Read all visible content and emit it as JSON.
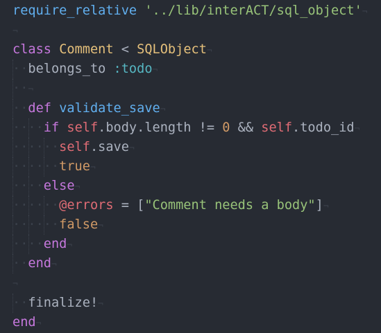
{
  "editor": {
    "language": "Ruby",
    "colors": {
      "background": "#272b33",
      "function": "#61afef",
      "string": "#98c379",
      "keyword": "#c678dd",
      "class": "#e5c07b",
      "symbol": "#56b6c2",
      "self": "#e06c75",
      "number": "#d19a66",
      "plain": "#abb2bf"
    },
    "lines": [
      {
        "indent": 0,
        "tokens": [
          {
            "t": "require_relative",
            "k": "fn"
          },
          {
            "t": " ",
            "k": "plain"
          },
          {
            "t": "'../lib/interACT/sql_object'",
            "k": "str"
          }
        ]
      },
      {
        "indent": 0,
        "tokens": []
      },
      {
        "indent": 0,
        "tokens": [
          {
            "t": "class",
            "k": "kw"
          },
          {
            "t": " ",
            "k": "plain"
          },
          {
            "t": "Comment",
            "k": "cls"
          },
          {
            "t": " < ",
            "k": "plain"
          },
          {
            "t": "SQLObject",
            "k": "cls"
          }
        ]
      },
      {
        "indent": 1,
        "tokens": [
          {
            "t": "belongs_to",
            "k": "plain"
          },
          {
            "t": " ",
            "k": "plain"
          },
          {
            "t": ":todo",
            "k": "sym"
          }
        ]
      },
      {
        "indent": 1,
        "tokens": []
      },
      {
        "indent": 1,
        "tokens": [
          {
            "t": "def",
            "k": "kw"
          },
          {
            "t": " ",
            "k": "plain"
          },
          {
            "t": "validate_save",
            "k": "fn"
          }
        ]
      },
      {
        "indent": 2,
        "tokens": [
          {
            "t": "if",
            "k": "kw"
          },
          {
            "t": " ",
            "k": "plain"
          },
          {
            "t": "self",
            "k": "self"
          },
          {
            "t": ".body.length != ",
            "k": "plain"
          },
          {
            "t": "0",
            "k": "num"
          },
          {
            "t": " && ",
            "k": "plain"
          },
          {
            "t": "self",
            "k": "self"
          },
          {
            "t": ".todo_id",
            "k": "plain"
          }
        ]
      },
      {
        "indent": 3,
        "tokens": [
          {
            "t": "self",
            "k": "self"
          },
          {
            "t": ".save",
            "k": "plain"
          }
        ]
      },
      {
        "indent": 3,
        "tokens": [
          {
            "t": "true",
            "k": "bool"
          }
        ]
      },
      {
        "indent": 2,
        "tokens": [
          {
            "t": "else",
            "k": "kw"
          }
        ]
      },
      {
        "indent": 3,
        "tokens": [
          {
            "t": "@errors",
            "k": "ivar"
          },
          {
            "t": " = [",
            "k": "plain"
          },
          {
            "t": "\"Comment needs a body\"",
            "k": "str"
          },
          {
            "t": "]",
            "k": "plain"
          }
        ]
      },
      {
        "indent": 3,
        "tokens": [
          {
            "t": "false",
            "k": "bool"
          }
        ]
      },
      {
        "indent": 2,
        "tokens": [
          {
            "t": "end",
            "k": "kw"
          }
        ]
      },
      {
        "indent": 1,
        "tokens": [
          {
            "t": "end",
            "k": "kw"
          }
        ]
      },
      {
        "indent": 0,
        "tokens": []
      },
      {
        "indent": 1,
        "tokens": [
          {
            "t": "finalize!",
            "k": "plain"
          }
        ]
      },
      {
        "indent": 0,
        "tokens": [
          {
            "t": "end",
            "k": "kw"
          }
        ]
      }
    ],
    "invisibles": {
      "space": "·",
      "eol": "¬"
    }
  }
}
